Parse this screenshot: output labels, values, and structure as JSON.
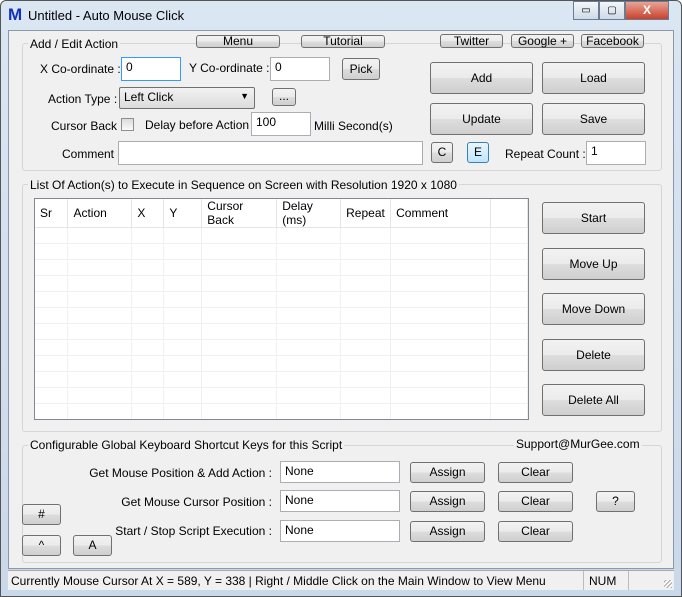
{
  "window": {
    "title": "Untitled - Auto Mouse Click",
    "logo": "M",
    "minimize": "▭",
    "maximize": "▢",
    "close": "X"
  },
  "edit": {
    "group_label": "Add / Edit Action",
    "menu": "Menu",
    "tutorial": "Tutorial",
    "twitter": "Twitter",
    "google": "Google +",
    "facebook": "Facebook",
    "x_label": "X Co-ordinate :",
    "x_value": "0",
    "y_label": "Y Co-ordinate :",
    "y_value": "0",
    "pick": "Pick",
    "action_type_label": "Action Type :",
    "action_type_value": "Left Click",
    "ellipsis": "...",
    "cursor_back_label": "Cursor Back :",
    "cursor_back_checked": false,
    "delay_label": "Delay before Action :",
    "delay_value": "100",
    "delay_unit": "Milli Second(s)",
    "comment_label": "Comment :",
    "comment_value": "",
    "c": "C",
    "e": "E",
    "repeat_label": "Repeat Count :",
    "repeat_value": "1",
    "add": "Add",
    "load": "Load",
    "update": "Update",
    "save": "Save"
  },
  "list": {
    "group_label": "List Of Action(s) to Execute in Sequence on Screen with Resolution 1920 x 1080",
    "columns": [
      "Sr",
      "Action",
      "X",
      "Y",
      "Cursor Back",
      "Delay (ms)",
      "Repeat",
      "Comment",
      ""
    ],
    "rows": [],
    "start": "Start",
    "move_up": "Move Up",
    "move_down": "Move Down",
    "delete": "Delete",
    "delete_all": "Delete All"
  },
  "shortcuts": {
    "group_label": "Configurable Global Keyboard Shortcut Keys for this Script",
    "support": "Support@MurGee.com",
    "items": [
      {
        "label": "Get Mouse Position & Add Action :",
        "value": "None",
        "assign": "Assign",
        "clear": "Clear"
      },
      {
        "label": "Get Mouse Cursor Position :",
        "value": "None",
        "assign": "Assign",
        "clear": "Clear"
      },
      {
        "label": "Start / Stop Script Execution :",
        "value": "None",
        "assign": "Assign",
        "clear": "Clear"
      }
    ],
    "help": "?",
    "hash": "#",
    "caret": "^",
    "a": "A"
  },
  "status": {
    "text": "Currently Mouse Cursor At X = 589, Y = 338 | Right / Middle Click on the Main Window to View Menu",
    "num": "NUM"
  }
}
